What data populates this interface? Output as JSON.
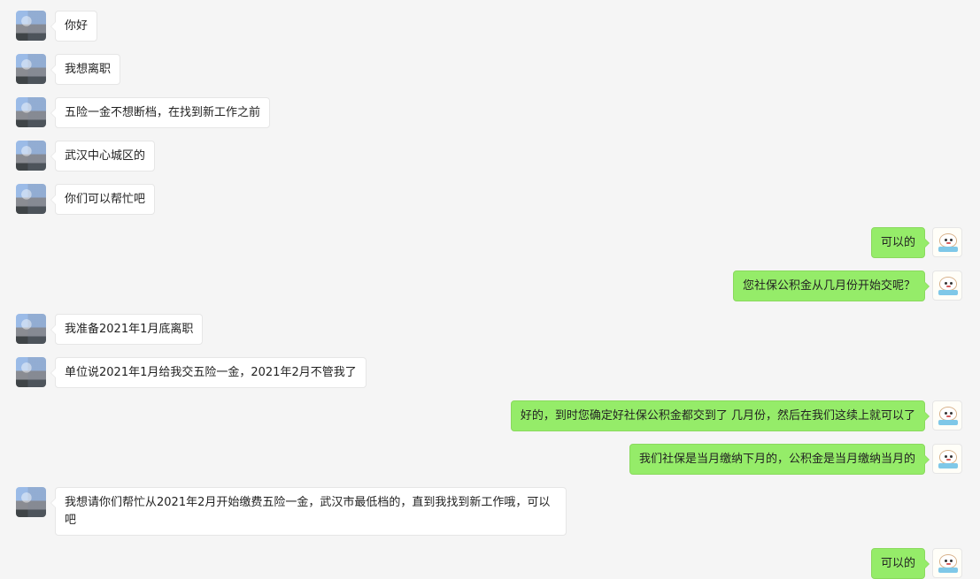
{
  "messages": [
    {
      "side": "left",
      "text": "你好"
    },
    {
      "side": "left",
      "text": "我想离职"
    },
    {
      "side": "left",
      "text": "五险一金不想断档，在找到新工作之前"
    },
    {
      "side": "left",
      "text": "武汉中心城区的"
    },
    {
      "side": "left",
      "text": "你们可以帮忙吧"
    },
    {
      "side": "right",
      "text": "可以的"
    },
    {
      "side": "right",
      "text": "您社保公积金从几月份开始交呢？"
    },
    {
      "side": "left",
      "text": "我准备2021年1月底离职"
    },
    {
      "side": "left",
      "text": "单位说2021年1月给我交五险一金，2021年2月不管我了"
    },
    {
      "side": "right",
      "text": "好的，到时您确定好社保公积金都交到了 几月份，然后在我们这续上就可以了"
    },
    {
      "side": "right",
      "text": "我们社保是当月缴纳下月的，公积金是当月缴纳当月的"
    },
    {
      "side": "left",
      "text": "我想请你们帮忙从2021年2月开始缴费五险一金，武汉市最低档的，直到我找到新工作哦，可以吧"
    },
    {
      "side": "right",
      "text": "可以的"
    }
  ]
}
